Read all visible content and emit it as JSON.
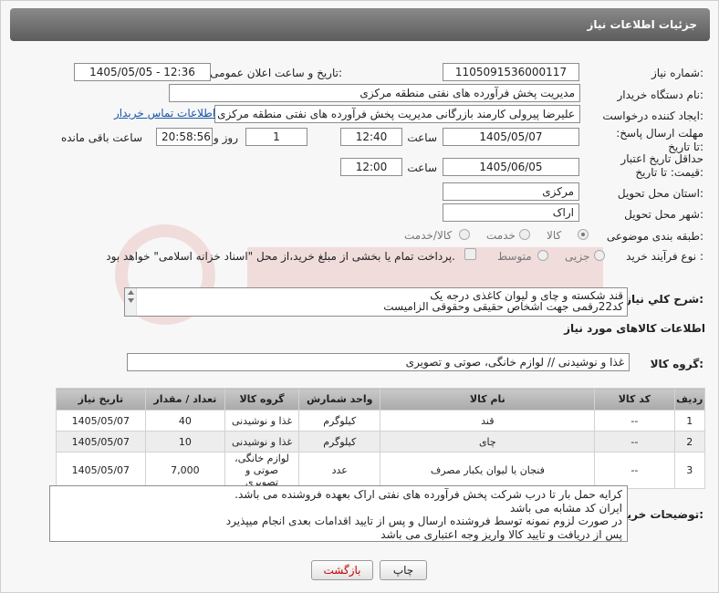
{
  "header": {
    "title": "جزئیات اطلاعات نیاز"
  },
  "fields": {
    "need_number_label": "شماره نیاز:",
    "need_number": "1105091536000117",
    "announce_label": "تاریخ و ساعت اعلان عمومی:",
    "announce_value": "1405/05/05 - 12:36",
    "buyer_org_label": "نام دستگاه خریدار:",
    "buyer_org": "مدیریت پخش فرآورده های نفتی منطقه مرکزی",
    "creator_label": "ایجاد کننده درخواست:",
    "creator": "علیرضا پیرولی کارمند بازرگانی مدیریت پخش فرآورده های نفتی منطقه مرکزی",
    "contact_link": "اطلاعات تماس خریدار",
    "deadline_label": "مهلت ارسال پاسخ: تا تاریخ:",
    "deadline_date": "1405/05/07",
    "time_label": "ساعت",
    "deadline_time": "12:40",
    "days_value": "1",
    "days_label": "روز و",
    "remaining_time": "20:58:56",
    "remaining_label": "ساعت باقی مانده",
    "validity_label": "حداقل تاریخ اعتبار قیمت: تا تاریخ:",
    "validity_date": "1405/06/05",
    "validity_time_label": "ساعت",
    "validity_time": "12:00",
    "province_label": "استان محل تحویل:",
    "province": "مرکزی",
    "city_label": "شهر محل تحویل:",
    "city": "اراک",
    "category_label": "طبقه بندی موضوعی:",
    "category_options": [
      "کالا",
      "خدمت",
      "کالا/خدمت"
    ],
    "process_label": "نوع فرآیند خرید :",
    "process_options": [
      "جزیی",
      "متوسط"
    ],
    "payment_text": "پرداخت تمام یا بخشی از مبلغ خرید،از محل \"اسناد خزانه اسلامی\" خواهد بود."
  },
  "summary": {
    "label": "شرح کلي نياز:",
    "line1": "قند شکسته و چای و لیوان کاغذی درجه یک",
    "line2": "کد22رقمی  جهت اشخاص حقیقی وحقوقی الزامیست"
  },
  "goods_section": {
    "title": "اطلاعات کالاهای مورد نیاز",
    "group_label": "گروه کالا:",
    "group_value": "غذا و نوشیدنی // لوازم خانگی، صوتی و تصویری"
  },
  "table": {
    "headers": [
      "ردیف",
      "کد کالا",
      "نام کالا",
      "واحد شمارش",
      "گروه کالا",
      "تعداد / مقدار",
      "تاریخ نیاز"
    ],
    "rows": [
      {
        "n": "1",
        "code": "--",
        "name": "قند",
        "unit": "کیلوگرم",
        "group": "غذا و نوشیدنی",
        "qty": "40",
        "date": "1405/05/07"
      },
      {
        "n": "2",
        "code": "--",
        "name": "چای",
        "unit": "کیلوگرم",
        "group": "غذا و نوشیدنی",
        "qty": "10",
        "date": "1405/05/07"
      },
      {
        "n": "3",
        "code": "--",
        "name": "فنجان یا لیوان یکبار مصرف",
        "unit": "عدد",
        "group": "لوازم خانگی، صوتی و تصویری",
        "qty": "7,000",
        "date": "1405/05/07"
      }
    ]
  },
  "notes": {
    "label": "توضیحات خریدار:",
    "text": "کرایه حمل بار تا درب شرکت  پخش فرآورده های نفتی اراک بعهده فروشنده می باشد.\nایران کد مشابه می باشد\nدر صورت لزوم نمونه توسط فروشنده ارسال و پس از تایید اقدامات بعدی انجام میپذیرد\nپس از دریافت و تایید کالا واریز وجه اعتباری می باشد"
  },
  "buttons": {
    "print": "چاپ",
    "back": "بازگشت"
  }
}
